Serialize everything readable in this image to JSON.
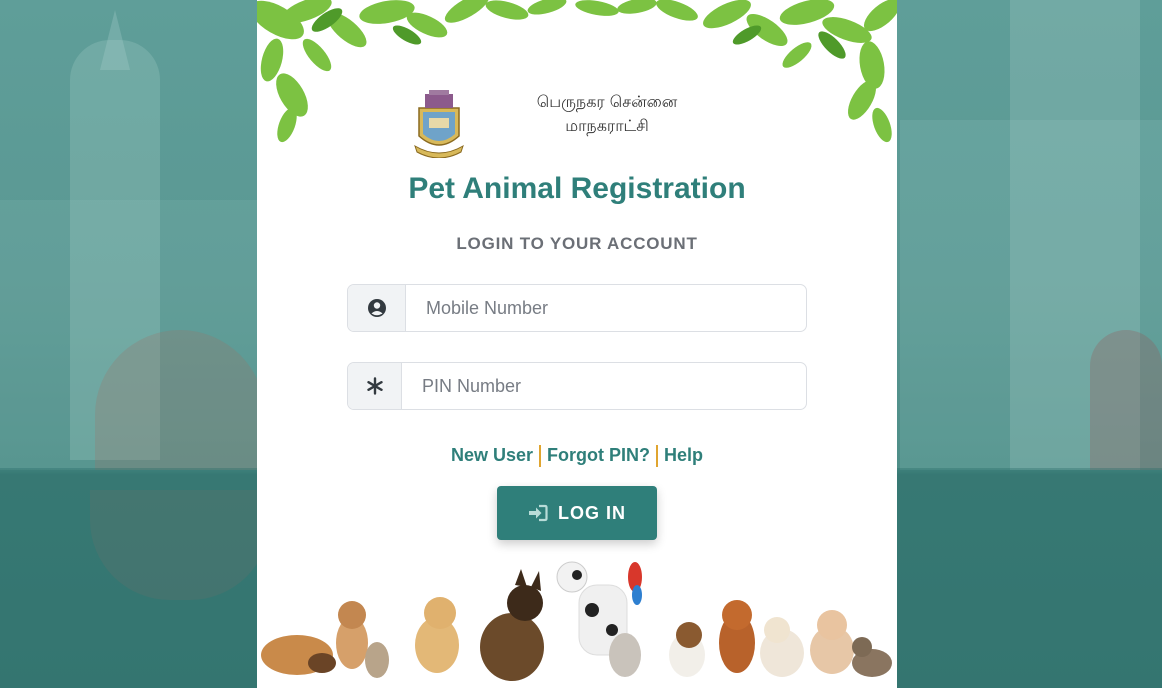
{
  "header": {
    "org_line1": "பெருநகர சென்னை",
    "org_line2": "மாநகராட்சி",
    "title": "Pet Animal Registration",
    "subtitle": "LOGIN TO YOUR ACCOUNT"
  },
  "form": {
    "mobile": {
      "placeholder": "Mobile Number",
      "value": "",
      "icon": "user-circle-icon"
    },
    "pin": {
      "placeholder": "PIN Number",
      "value": "",
      "icon": "asterisk-icon"
    }
  },
  "links": {
    "new_user": "New User",
    "forgot_pin": "Forgot PIN?",
    "help": "Help"
  },
  "login_button": {
    "label": "LOG IN",
    "icon": "sign-in-icon"
  },
  "colors": {
    "accent": "#2f7f7a",
    "separator": "#e0a530",
    "muted_text": "#6b6f76"
  }
}
